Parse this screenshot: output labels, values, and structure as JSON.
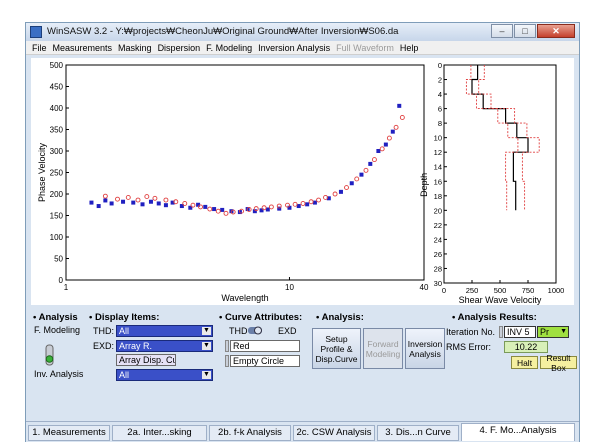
{
  "window": {
    "title": "WinSASW 3.2 - Y:₩projects₩CheonJu₩Original Ground₩After Inversion₩S06.da",
    "accent": "#3a50c8"
  },
  "menu": [
    "File",
    "Measurements",
    "Masking",
    "Dispersion",
    "F. Modeling",
    "Inversion Analysis",
    "Full Waveform",
    "Help"
  ],
  "menu_disabled": [
    "Full Waveform"
  ],
  "chart_data": [
    {
      "type": "scatter",
      "xlabel": "Wavelength",
      "ylabel": "Phase Velocity",
      "x_scale": "log",
      "xlim": [
        1,
        40
      ],
      "ylim": [
        0,
        500
      ],
      "x_ticks": [
        "1",
        "10",
        "40"
      ],
      "y_ticks": [
        "0",
        "50",
        "100",
        "150",
        "200",
        "250",
        "300",
        "350",
        "400",
        "450",
        "500"
      ],
      "series": [
        {
          "color": "#2020c0",
          "marker": "filled-square",
          "points": [
            [
              1.3,
              180
            ],
            [
              1.4,
              172
            ],
            [
              1.5,
              185
            ],
            [
              1.6,
              178
            ],
            [
              1.8,
              182
            ],
            [
              2.0,
              180
            ],
            [
              2.2,
              176
            ],
            [
              2.4,
              182
            ],
            [
              2.6,
              178
            ],
            [
              2.8,
              174
            ],
            [
              3.0,
              180
            ],
            [
              3.3,
              172
            ],
            [
              3.6,
              168
            ],
            [
              3.9,
              175
            ],
            [
              4.2,
              170
            ],
            [
              4.6,
              165
            ],
            [
              5.0,
              163
            ],
            [
              5.5,
              160
            ],
            [
              6.0,
              158
            ],
            [
              6.5,
              165
            ],
            [
              7.0,
              160
            ],
            [
              7.5,
              162
            ],
            [
              8.0,
              164
            ],
            [
              9.0,
              166
            ],
            [
              10.0,
              168
            ],
            [
              11.0,
              172
            ],
            [
              12.0,
              176
            ],
            [
              13.0,
              180
            ],
            [
              15.0,
              190
            ],
            [
              17.0,
              205
            ],
            [
              19.0,
              225
            ],
            [
              21.0,
              245
            ],
            [
              23.0,
              270
            ],
            [
              25.0,
              300
            ],
            [
              27.0,
              315
            ],
            [
              29.0,
              345
            ],
            [
              31.0,
              405
            ]
          ]
        },
        {
          "color": "#e04040",
          "marker": "empty-circle",
          "points": [
            [
              1.5,
              195
            ],
            [
              1.7,
              188
            ],
            [
              1.9,
              192
            ],
            [
              2.1,
              186
            ],
            [
              2.3,
              194
            ],
            [
              2.5,
              190
            ],
            [
              2.8,
              186
            ],
            [
              3.1,
              182
            ],
            [
              3.4,
              178
            ],
            [
              3.7,
              174
            ],
            [
              4.0,
              170
            ],
            [
              4.4,
              165
            ],
            [
              4.8,
              160
            ],
            [
              5.2,
              155
            ],
            [
              5.6,
              158
            ],
            [
              6.1,
              160
            ],
            [
              6.6,
              164
            ],
            [
              7.1,
              166
            ],
            [
              7.7,
              168
            ],
            [
              8.3,
              170
            ],
            [
              9.0,
              172
            ],
            [
              9.8,
              174
            ],
            [
              10.6,
              176
            ],
            [
              11.5,
              178
            ],
            [
              12.5,
              182
            ],
            [
              13.5,
              186
            ],
            [
              14.5,
              192
            ],
            [
              16.0,
              200
            ],
            [
              18.0,
              215
            ],
            [
              20.0,
              235
            ],
            [
              22.0,
              255
            ],
            [
              24.0,
              280
            ],
            [
              26.0,
              305
            ],
            [
              28.0,
              330
            ],
            [
              30.0,
              355
            ],
            [
              32.0,
              378
            ]
          ]
        }
      ]
    },
    {
      "type": "line",
      "xlabel": "Shear Wave Velocity",
      "ylabel": "Depth",
      "xlim": [
        0,
        1000
      ],
      "ylim": [
        30,
        0
      ],
      "x_ticks": [
        "0",
        "250",
        "500",
        "750",
        "1000"
      ],
      "y_ticks": [
        "0",
        "2",
        "4",
        "6",
        "8",
        "10",
        "12",
        "14",
        "16",
        "18",
        "20",
        "22",
        "24",
        "26",
        "28",
        "30"
      ],
      "series": [
        {
          "color": "#000000",
          "style": "solid",
          "points": [
            [
              300,
              0
            ],
            [
              300,
              2
            ],
            [
              250,
              2
            ],
            [
              250,
              4
            ],
            [
              350,
              4
            ],
            [
              350,
              6
            ],
            [
              550,
              6
            ],
            [
              550,
              8
            ],
            [
              650,
              8
            ],
            [
              650,
              10
            ],
            [
              750,
              10
            ],
            [
              750,
              12
            ],
            [
              620,
              12
            ],
            [
              620,
              16
            ],
            [
              640,
              16
            ],
            [
              640,
              20
            ]
          ]
        },
        {
          "color": "#e04040",
          "style": "dashed",
          "points": [
            [
              240,
              0
            ],
            [
              240,
              2
            ],
            [
              200,
              2
            ],
            [
              200,
              4
            ],
            [
              290,
              4
            ],
            [
              290,
              6
            ],
            [
              480,
              6
            ],
            [
              480,
              8
            ],
            [
              570,
              8
            ],
            [
              570,
              10
            ],
            [
              660,
              10
            ],
            [
              660,
              12
            ],
            [
              550,
              12
            ],
            [
              550,
              16
            ],
            [
              560,
              16
            ],
            [
              560,
              20
            ]
          ]
        },
        {
          "color": "#e04040",
          "style": "dashed",
          "points": [
            [
              360,
              0
            ],
            [
              360,
              2
            ],
            [
              310,
              2
            ],
            [
              310,
              4
            ],
            [
              420,
              4
            ],
            [
              420,
              6
            ],
            [
              630,
              6
            ],
            [
              630,
              8
            ],
            [
              740,
              8
            ],
            [
              740,
              10
            ],
            [
              850,
              10
            ],
            [
              850,
              12
            ],
            [
              700,
              12
            ],
            [
              700,
              16
            ],
            [
              720,
              16
            ],
            [
              720,
              20
            ]
          ]
        }
      ]
    }
  ],
  "panel": {
    "analysis_left_title": "• Analysis",
    "f_modeling": "F. Modeling",
    "inv_analysis": "Inv. Analysis",
    "display_title": "• Display Items:",
    "thd_label": "THD:",
    "thd_value": "All",
    "exd_label": "EXD:",
    "exd_value": "Array R.",
    "array_disp": "Array Disp. Curve",
    "all_value": "All",
    "curve_title": "• Curve Attributes:",
    "thd_small": "THD",
    "exd_small": "EXD",
    "color_value": "Red",
    "marker_value": "Empty Circle",
    "analysis_mid_title": "• Analysis:",
    "setup_button": "Setup Profile & Disp.Curve",
    "forward_button": "Forward Modeling",
    "inversion_button": "Inversion Analysis",
    "results_title": "• Analysis Results:",
    "iteration_label": "Iteration No.",
    "iteration_value": "INV 5",
    "pr_value": "Pr",
    "rms_label": "RMS Error:",
    "rms_value": "10.22",
    "halt_button": "Halt",
    "result_box_button": "Result Box"
  },
  "tabs": [
    {
      "label": "1. Measurements",
      "active": false
    },
    {
      "label": "2a. Inter...sking",
      "active": false
    },
    {
      "label": "2b. f-k Analysis",
      "active": false
    },
    {
      "label": "2c. CSW Analysis",
      "active": false
    },
    {
      "label": "3. Dis...n Curve",
      "active": false
    },
    {
      "label": "4. F. Mo...Analysis",
      "active": true
    }
  ]
}
